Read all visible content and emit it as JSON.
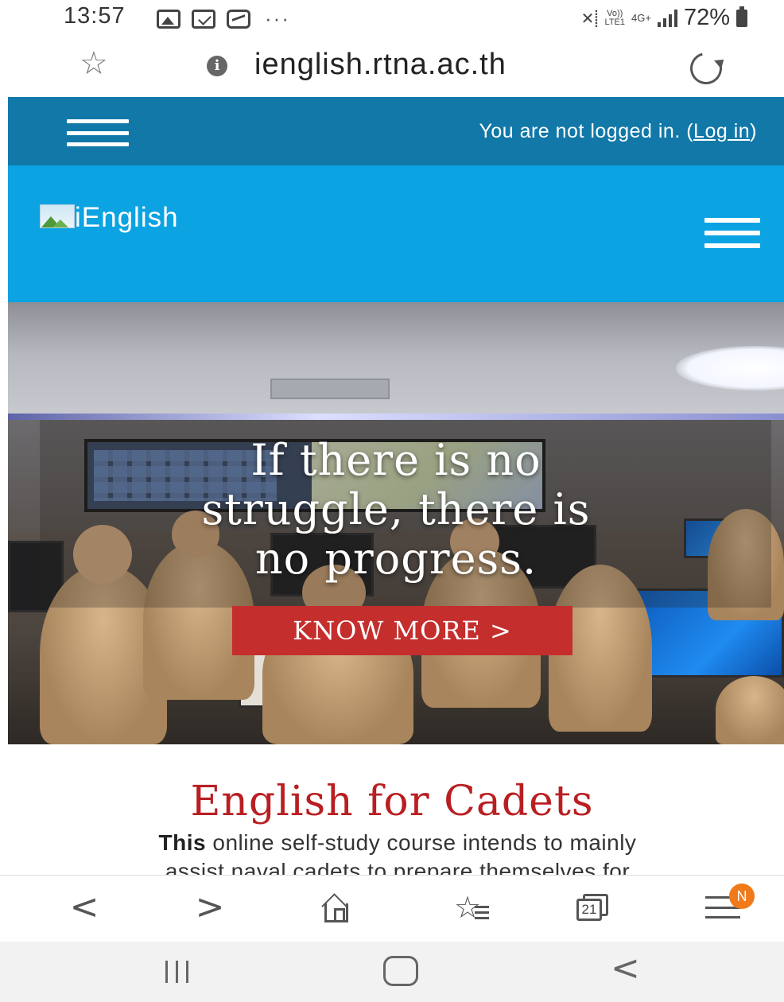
{
  "status_bar": {
    "time": "13:57",
    "network_small_top": "Vo))",
    "network_small_bottom": "LTE1",
    "network_type": "4G+",
    "battery_percent": "72%"
  },
  "browser": {
    "url": "ienglish.rtna.ac.th",
    "tabs_count": "21",
    "menu_badge": "N"
  },
  "site": {
    "login_prefix": "You are not logged in. (",
    "login_link": "Log in",
    "login_suffix": ")",
    "logo_text": "iEnglish",
    "brand_color": "#0ba3e2",
    "topbar_color": "#1278a8"
  },
  "hero": {
    "quote_line1": "If there is no",
    "quote_line2": "struggle, there is",
    "quote_line3": "no progress.",
    "cta_label": "KNOW MORE  >",
    "cta_color": "#c42e2d"
  },
  "section": {
    "title": "English for Cadets",
    "title_color": "#b91f22",
    "intro_bold": "This",
    "intro_line1_rest": " online self-study course intends to mainly",
    "intro_line2": "assist naval cadets to prepare themselves for"
  },
  "icons": {
    "status_left": [
      "image-notification-icon",
      "mail-notification-icon",
      "message-notification-icon"
    ],
    "toolbar": [
      "back-icon",
      "forward-icon",
      "home-icon",
      "bookmarks-icon",
      "tabs-icon",
      "menu-icon"
    ],
    "nav": [
      "recent-apps-icon",
      "home-nav-icon",
      "back-nav-icon"
    ]
  }
}
